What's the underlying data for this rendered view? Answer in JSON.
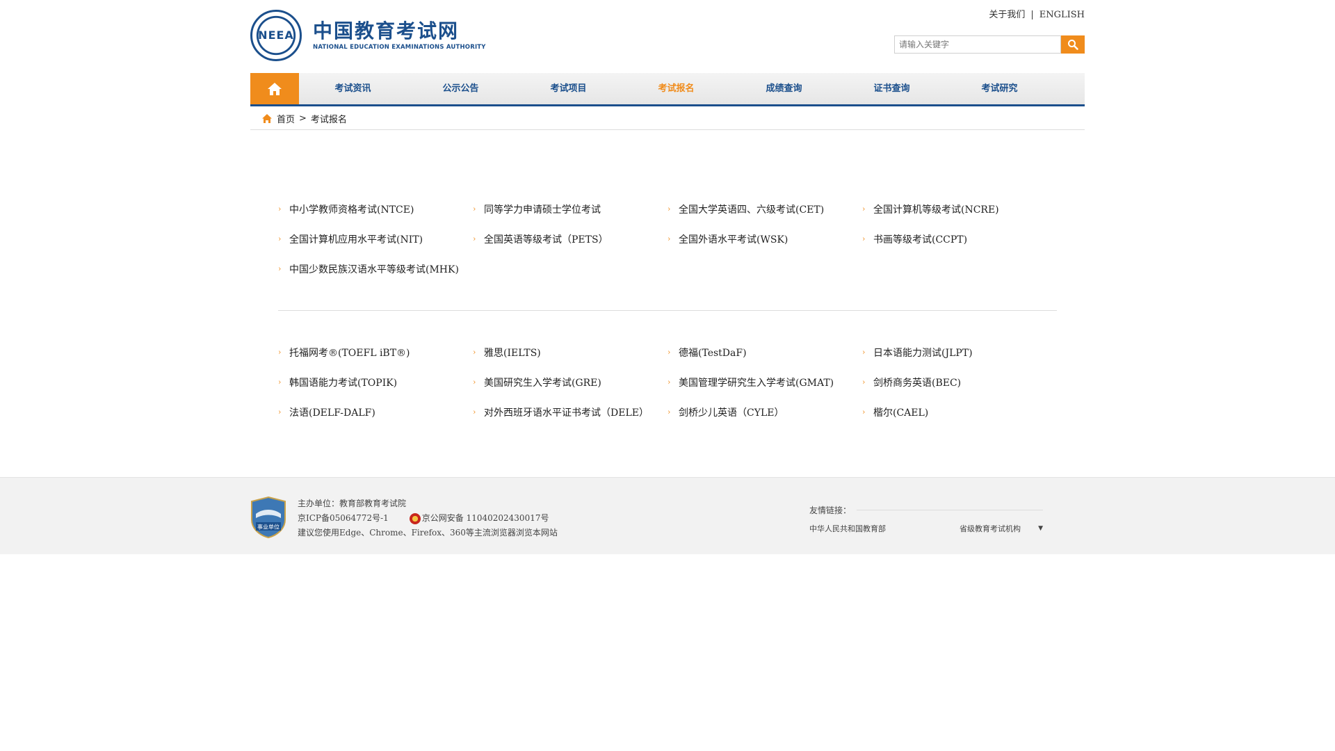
{
  "header": {
    "logo_emblem_text": "NEEA",
    "logo_title": "中国教育考试网",
    "logo_subtitle": "NATIONAL EDUCATION EXAMINATIONS AUTHORITY",
    "top_links": {
      "about": "关于我们",
      "separator": "|",
      "english": "ENGLISH"
    },
    "search": {
      "placeholder": "请输入关键字"
    }
  },
  "nav": {
    "items": [
      {
        "label": "考试资讯"
      },
      {
        "label": "公示公告"
      },
      {
        "label": "考试项目"
      },
      {
        "label": "考试报名",
        "active": true
      },
      {
        "label": "成绩查询"
      },
      {
        "label": "证书查询"
      },
      {
        "label": "考试研究"
      }
    ]
  },
  "breadcrumb": {
    "home": "首页",
    "separator": ">",
    "current": "考试报名"
  },
  "domestic_exams": [
    "中小学教师资格考试(NTCE)",
    "同等学力申请硕士学位考试",
    "全国大学英语四、六级考试(CET)",
    "全国计算机等级考试(NCRE)",
    "全国计算机应用水平考试(NIT)",
    "全国英语等级考试（PETS）",
    "全国外语水平考试(WSK)",
    "书画等级考试(CCPT)",
    "中国少数民族汉语水平等级考试(MHK)"
  ],
  "foreign_exams": [
    "托福网考®(TOEFL iBT®)",
    "雅思(IELTS)",
    "德福(TestDaF)",
    "日本语能力测试(JLPT)",
    "韩国语能力考试(TOPIK)",
    "美国研究生入学考试(GRE)",
    "美国管理学研究生入学考试(GMAT)",
    "剑桥商务英语(BEC)",
    "法语(DELF-DALF)",
    "对外西班牙语水平证书考试（DELE）",
    "剑桥少儿英语（CYLE）",
    "楷尔(CAEL)"
  ],
  "footer": {
    "badge_text": "事业单位",
    "sponsor": "主办单位：教育部教育考试院",
    "icp": "京ICP备05064772号-1",
    "police": "京公网安备 11040202430017号",
    "browser_tip": "建议您使用Edge、Chrome、Firefox、360等主流浏览器浏览本网站",
    "friends_title": "友情链接：",
    "friend_link": "中华人民共和国教育部",
    "province_select": "省级教育考试机构"
  },
  "colors": {
    "brand_blue": "#1b4f8c",
    "accent_orange": "#f08c1c"
  }
}
